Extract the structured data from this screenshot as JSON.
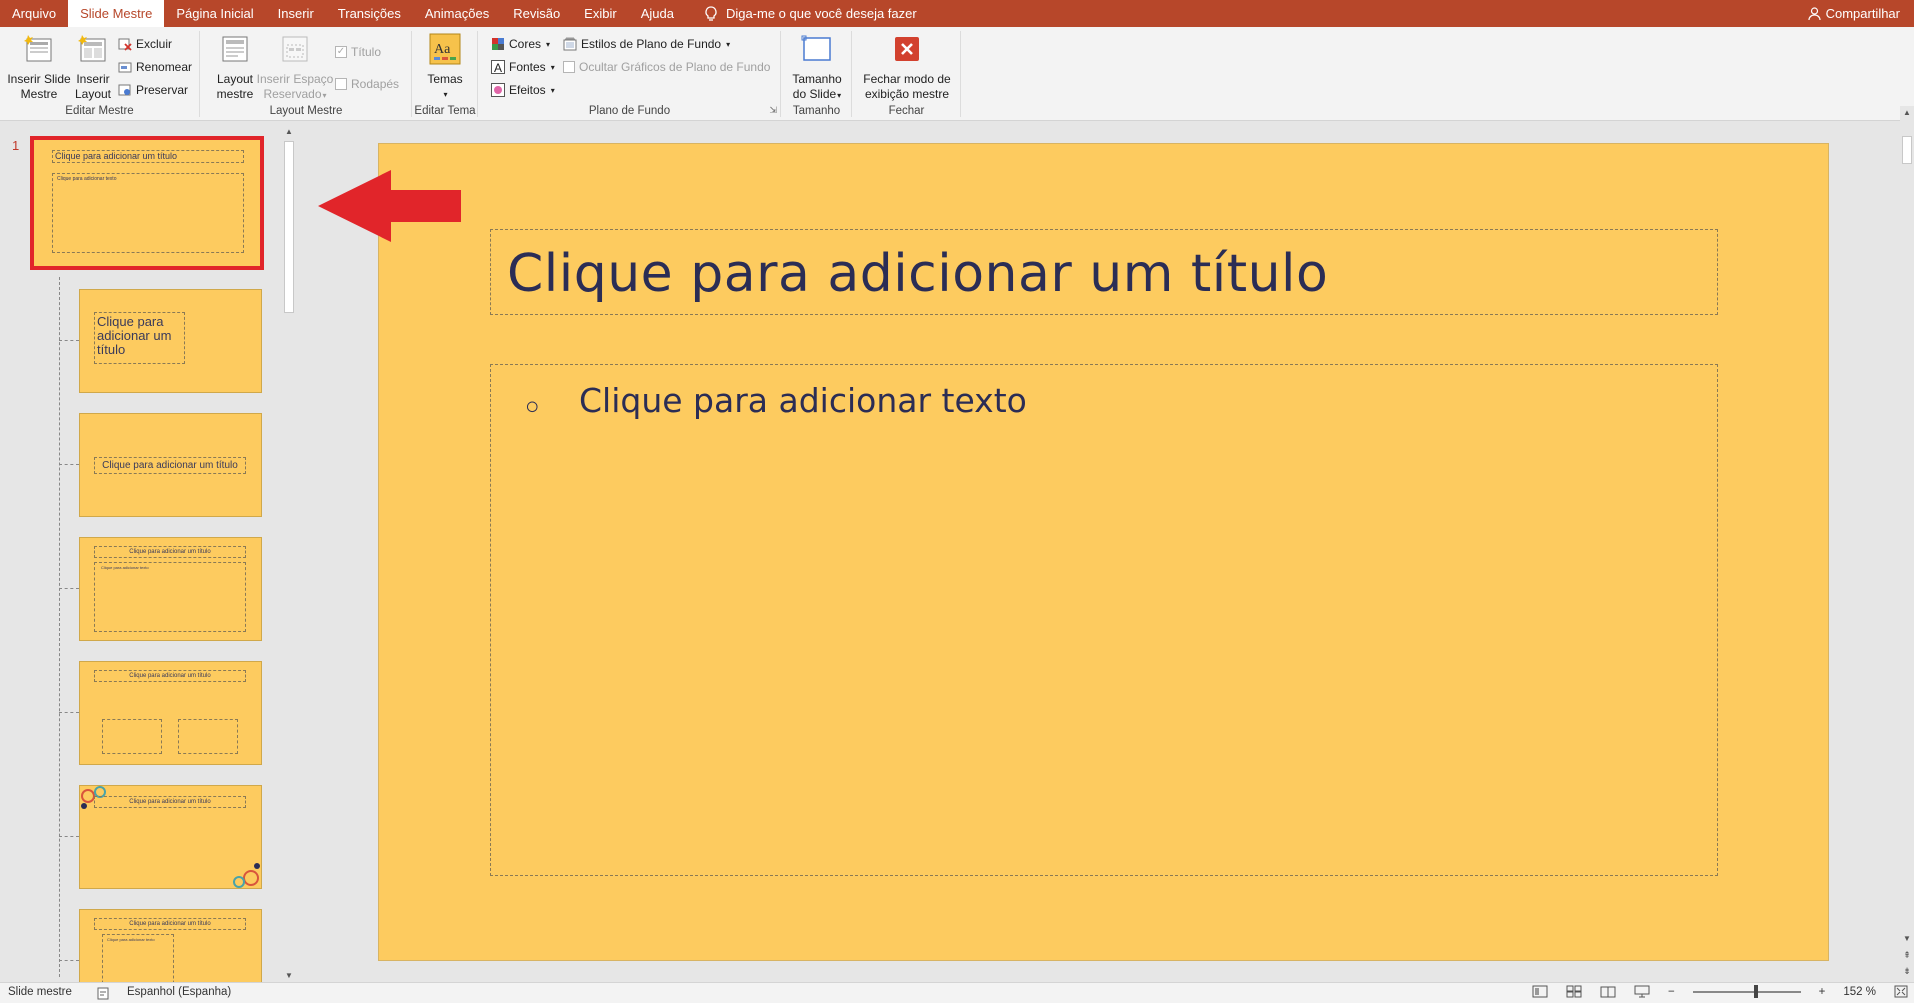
{
  "tabs": {
    "file": "Arquivo",
    "slide_master": "Slide Mestre",
    "home": "Página Inicial",
    "insert": "Inserir",
    "transitions": "Transições",
    "animations": "Animações",
    "review": "Revisão",
    "view": "Exibir",
    "help": "Ajuda",
    "tell_me": "Diga-me o que você deseja fazer",
    "share": "Compartilhar"
  },
  "ribbon": {
    "edit_master": {
      "label": "Editar Mestre",
      "insert_slide_master": [
        "Inserir Slide",
        "Mestre"
      ],
      "insert_layout": [
        "Inserir",
        "Layout"
      ],
      "delete": "Excluir",
      "rename": "Renomear",
      "preserve": "Preservar"
    },
    "master_layout": {
      "label": "Layout Mestre",
      "master_layout": [
        "Layout",
        "mestre"
      ],
      "insert_placeholder": [
        "Inserir Espaço",
        "Reservado"
      ],
      "title": "Título",
      "footers": "Rodapés"
    },
    "edit_theme": {
      "label": "Editar Tema",
      "themes": "Temas"
    },
    "background": {
      "label": "Plano de Fundo",
      "colors": "Cores",
      "fonts": "Fontes",
      "effects": "Efeitos",
      "background_styles": "Estilos de Plano de Fundo",
      "hide_background_graphics": "Ocultar Gráficos de Plano de Fundo"
    },
    "size": {
      "label": "Tamanho",
      "slide_size": [
        "Tamanho",
        "do Slide"
      ]
    },
    "close": {
      "label": "Fechar",
      "close_master_view": [
        "Fechar modo de",
        "exibição mestre"
      ]
    }
  },
  "thumbnails": {
    "master_number": "1",
    "master_title": "Clique para adicionar um título",
    "master_text": "Clique para adicionar texto",
    "layout2_title": "Clique para adicionar um título",
    "layout3_title": "Clique para adicionar um título",
    "layout4_title": "Clique para adicionar um título",
    "layout4_text": "Clique para adicionar texto",
    "layout5_title": "Clique para adicionar um título",
    "layout6_title": "Clique para adicionar um título",
    "layout7_title": "Clique para adicionar um título",
    "layout7_text": "Clique para adicionar texto"
  },
  "slide": {
    "title": "Clique para adicionar um título",
    "bullet": "○",
    "body": "Clique para adicionar texto"
  },
  "statusbar": {
    "view": "Slide mestre",
    "language": "Espanhol (Espanha)",
    "zoom": "152 %",
    "zoom_minus": "−",
    "zoom_plus": "+"
  },
  "colors": {
    "accent": "#b7472a",
    "slide_bg": "#fdcb5f",
    "text_dark": "#2b2d55",
    "arrow_red": "#e1252a"
  }
}
